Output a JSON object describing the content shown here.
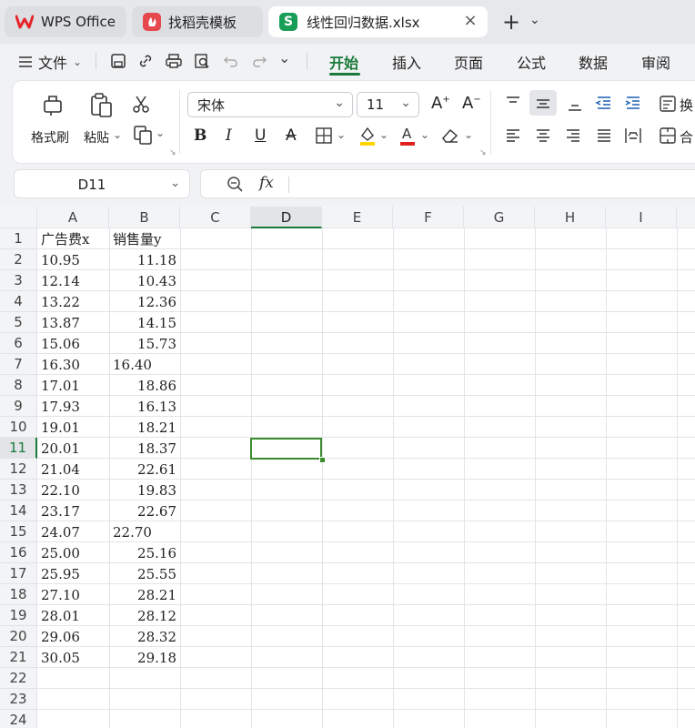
{
  "tabs": [
    {
      "label": "WPS Office",
      "icon": "wps-logo-icon"
    },
    {
      "label": "找稻壳模板",
      "icon": "daoke-icon"
    },
    {
      "label": "线性回归数据.xlsx",
      "icon": "spreadsheet-icon",
      "icon_letter": "S",
      "active": true
    }
  ],
  "menu": {
    "file_label": "文件",
    "ribbon_tabs": [
      "开始",
      "插入",
      "页面",
      "公式",
      "数据",
      "审阅"
    ],
    "active_tab": "开始"
  },
  "ribbon": {
    "format_painter": "格式刷",
    "paste": "粘贴",
    "font_name": "宋体",
    "font_size": "11",
    "wrap_label": "换",
    "merge_label": "合",
    "font_color": "#e02020",
    "highlight_color": "#ffd400"
  },
  "formula_bar": {
    "name_box": "D11",
    "fx_label": "fx",
    "content": ""
  },
  "sheet": {
    "columns": [
      "A",
      "B",
      "C",
      "D",
      "E",
      "F",
      "G",
      "H",
      "I"
    ],
    "active_column": "D",
    "active_row": 11,
    "row_numbers": [
      "1",
      "2",
      "3",
      "4",
      "5",
      "6",
      "7",
      "8",
      "9",
      "10",
      "11",
      "12",
      "13",
      "14",
      "15",
      "16",
      "17",
      "18",
      "19",
      "20",
      "21",
      "22",
      "23",
      "24"
    ],
    "header": {
      "a": "广告费x",
      "b": "销售量y"
    },
    "rows": [
      {
        "a": "10.95",
        "b": "11.18"
      },
      {
        "a": "12.14",
        "b": "10.43"
      },
      {
        "a": "13.22",
        "b": "12.36"
      },
      {
        "a": "13.87",
        "b": "14.15"
      },
      {
        "a": "15.06",
        "b": "15.73"
      },
      {
        "a": "16.30",
        "b": "16.40",
        "b_left": true
      },
      {
        "a": "17.01",
        "b": "18.86"
      },
      {
        "a": "17.93",
        "b": "16.13"
      },
      {
        "a": "19.01",
        "b": "18.21"
      },
      {
        "a": "20.01",
        "b": "18.37"
      },
      {
        "a": "21.04",
        "b": "22.61"
      },
      {
        "a": "22.10",
        "b": "19.83"
      },
      {
        "a": "23.17",
        "b": "22.67"
      },
      {
        "a": "24.07",
        "b": "22.70",
        "b_left": true
      },
      {
        "a": "25.00",
        "b": "25.16"
      },
      {
        "a": "25.95",
        "b": "25.55"
      },
      {
        "a": "27.10",
        "b": "28.21"
      },
      {
        "a": "28.01",
        "b": "28.12"
      },
      {
        "a": "29.06",
        "b": "28.32"
      },
      {
        "a": "30.05",
        "b": "29.18"
      }
    ]
  }
}
